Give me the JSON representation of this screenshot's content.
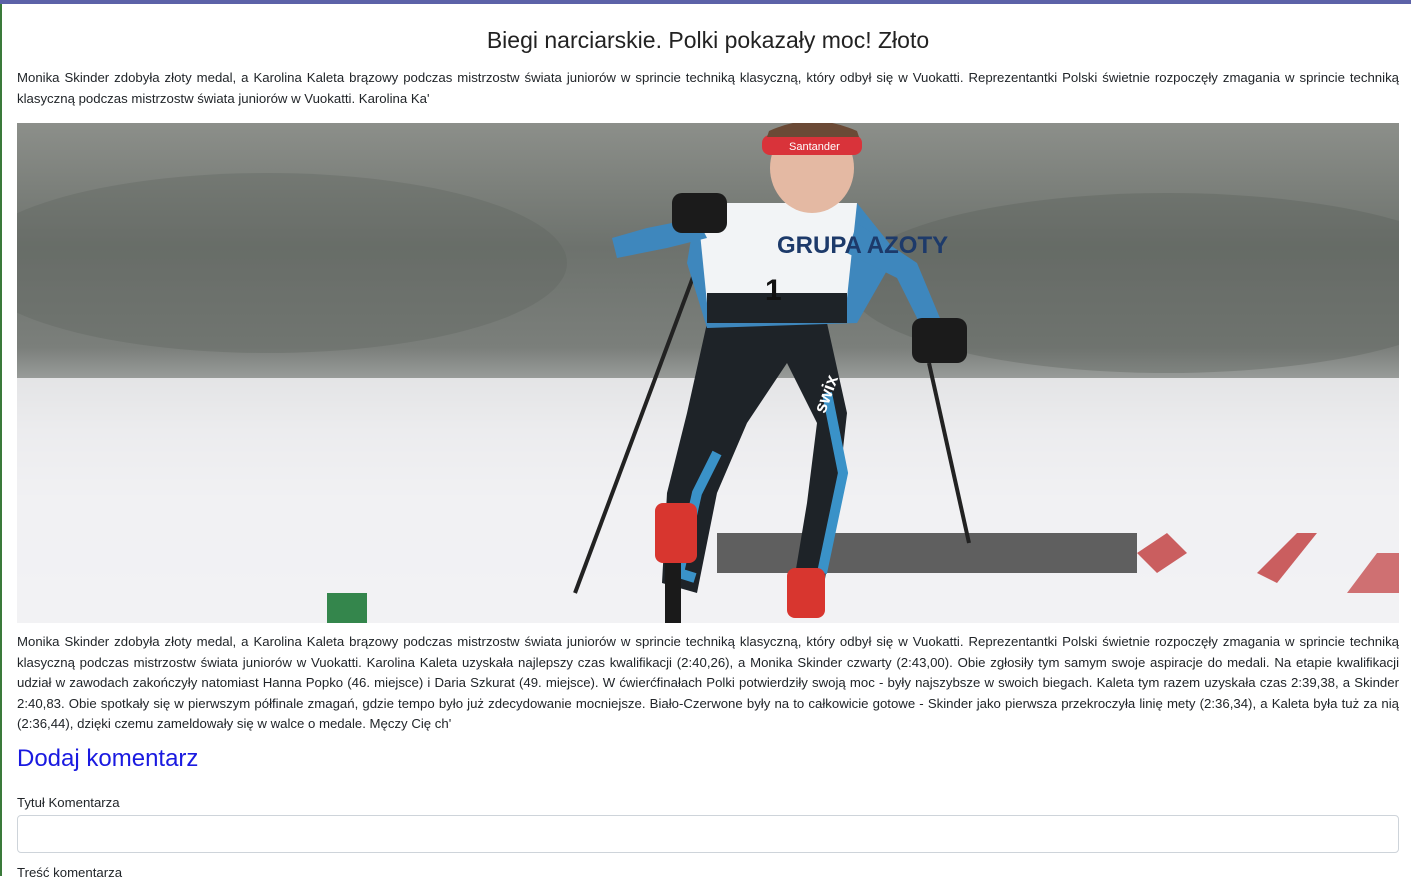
{
  "article": {
    "title": "Biegi narciarskie. Polki pokazały moc! Złoto",
    "lead": "Monika Skinder zdobyła złoty medal, a Karolina Kaleta brązowy podczas mistrzostw świata juniorów w sprincie techniką klasyczną, który odbył się w Vuokatti. Reprezentantki Polski świetnie rozpoczęły zmagania w sprincie techniką klasyczną podczas mistrzostw świata juniorów w Vuokatti. Karolina Ka'",
    "image": {
      "bib_sponsor": "GRUPA AZOTY",
      "bib_number": "1",
      "headband_text": "Santander",
      "suit_brand": "swix"
    },
    "body": "Monika Skinder zdobyła złoty medal, a Karolina Kaleta brązowy podczas mistrzostw świata juniorów w sprincie techniką klasyczną, który odbył się w Vuokatti. Reprezentantki Polski świetnie rozpoczęły zmagania w sprincie techniką klasyczną podczas mistrzostw świata juniorów w Vuokatti. Karolina Kaleta uzyskała najlepszy czas kwalifikacji (2:40,26), a Monika Skinder czwarty (2:43,00). Obie zgłosiły tym samym swoje aspiracje do medali. Na etapie kwalifikacji udział w zawodach zakończyły natomiast Hanna Popko (46. miejsce) i Daria Szkurat (49. miejsce). W ćwierćfinałach Polki potwierdziły swoją moc - były najszybsze w swoich biegach. Kaleta tym razem uzyskała czas 2:39,38, a Skinder 2:40,83. Obie spotkały się w pierwszym półfinale zmagań, gdzie tempo było już zdecydowanie mocniejsze. Biało-Czerwone były na to całkowicie gotowe - Skinder jako pierwsza przekroczyła linię mety (2:36,34), a Kaleta była tuż za nią (2:36,44), dzięki czemu zameldowały się w walce o medale. Męczy Cię ch'"
  },
  "comment_form": {
    "heading": "Dodaj komentarz",
    "title_label": "Tytuł Komentarza",
    "title_value": "",
    "content_label": "Treść komentarza"
  },
  "colors": {
    "heading_link": "#1a1ae0",
    "top_bar": "#5c62a8"
  }
}
